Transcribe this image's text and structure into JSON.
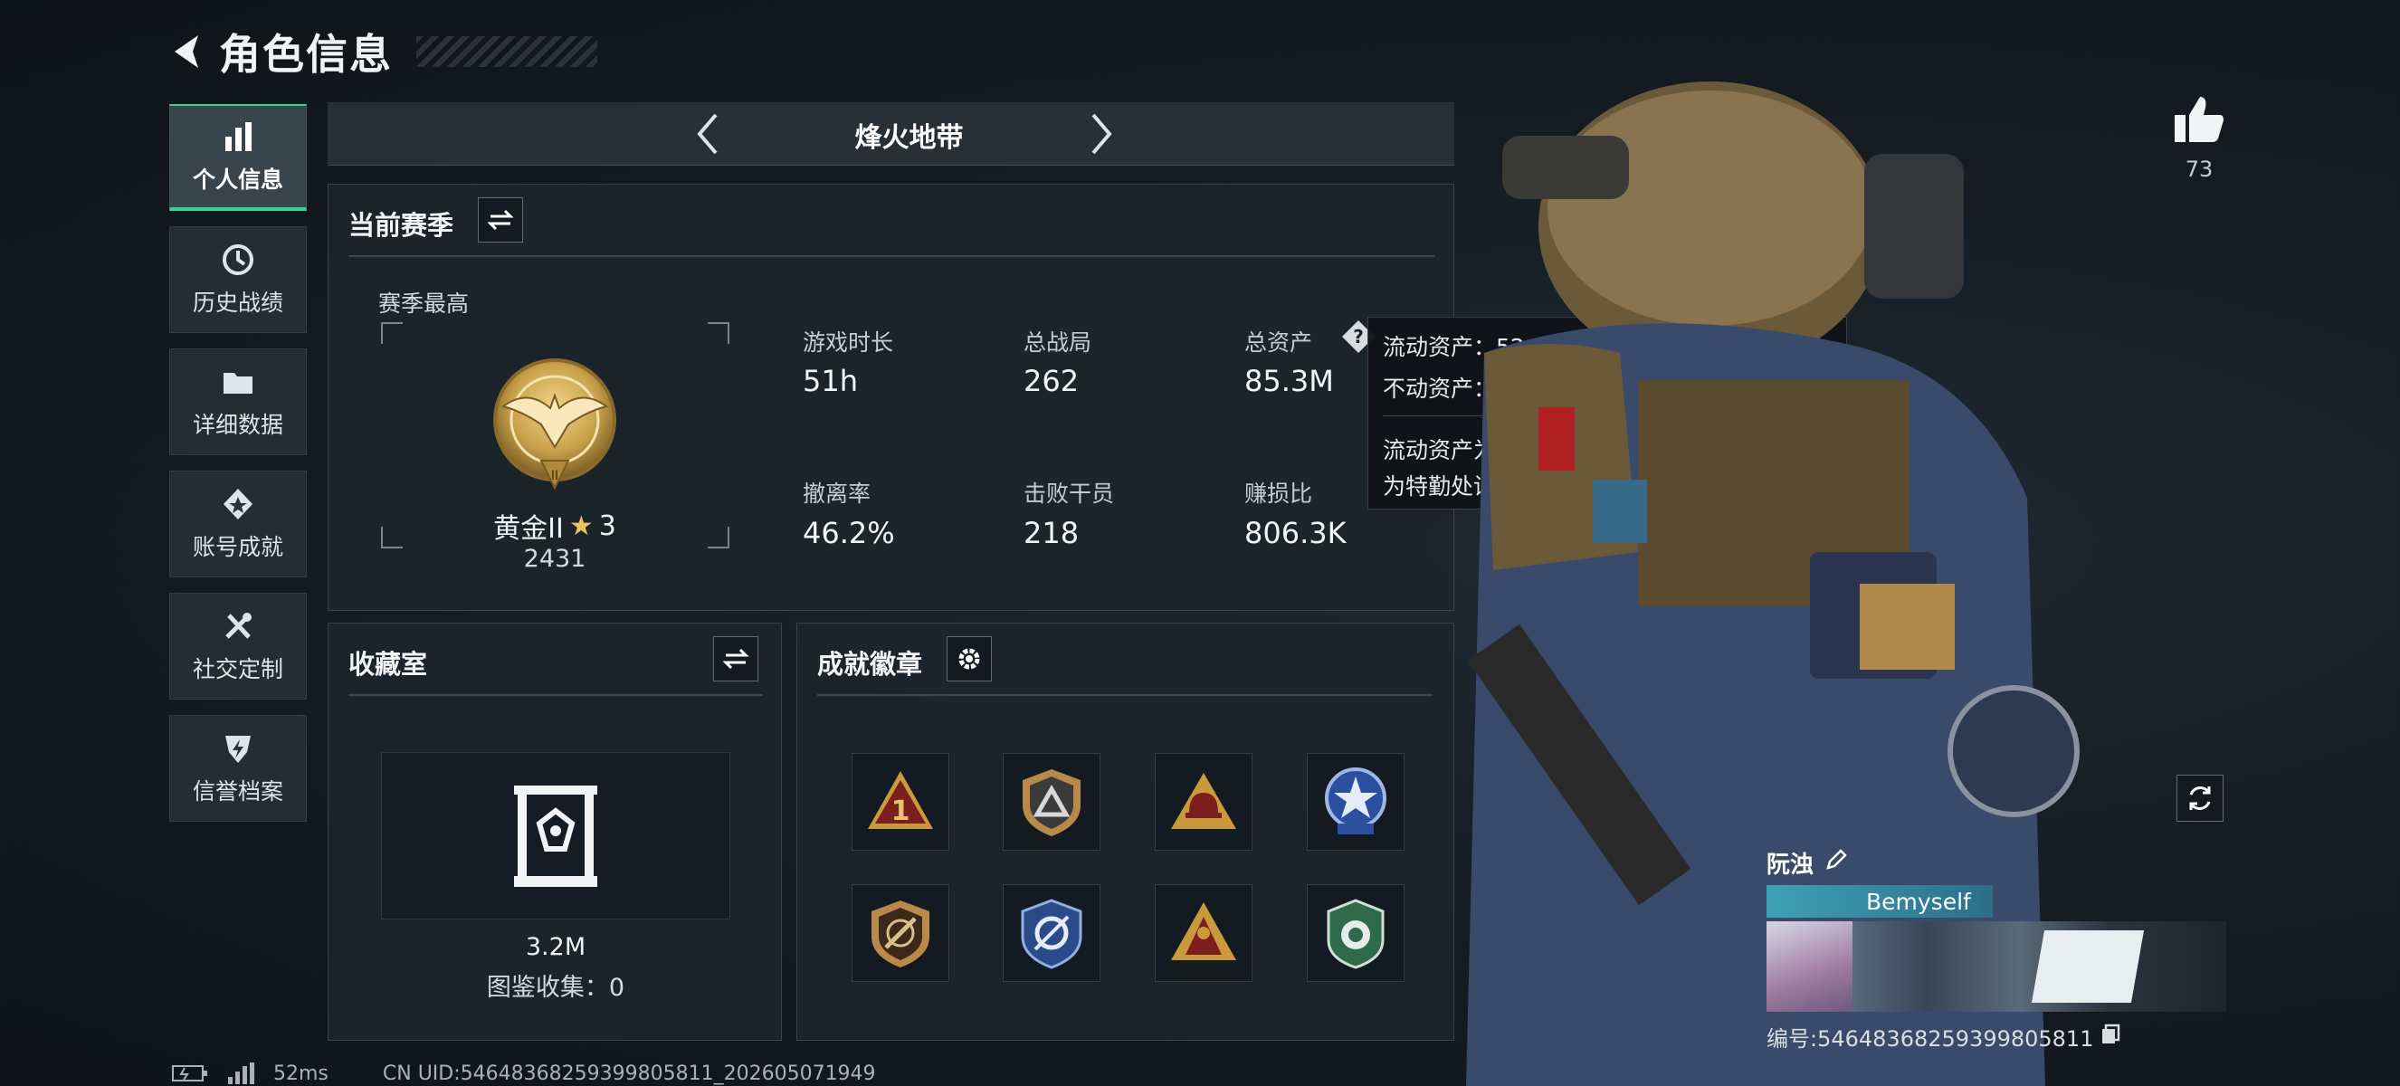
{
  "header": {
    "title": "角色信息"
  },
  "sidebar": {
    "items": [
      {
        "label": "个人信息",
        "icon": "bar-chart-icon",
        "active": true
      },
      {
        "label": "历史战绩",
        "icon": "history-icon"
      },
      {
        "label": "详细数据",
        "icon": "folder-icon"
      },
      {
        "label": "账号成就",
        "icon": "medal-icon"
      },
      {
        "label": "社交定制",
        "icon": "tools-icon"
      },
      {
        "label": "信誉档案",
        "icon": "shield-icon"
      }
    ]
  },
  "mode_selector": {
    "label": "烽火地带"
  },
  "season": {
    "title": "当前赛季",
    "best_label": "赛季最高",
    "rank_name": "黄金II",
    "rank_stars": "3",
    "rank_score": "2431",
    "stats": [
      {
        "label": "游戏时长",
        "value": "51h"
      },
      {
        "label": "总战局",
        "value": "262"
      },
      {
        "label": "总资产",
        "value": "85.3M"
      },
      {
        "label": "撤离率",
        "value": "46.2%"
      },
      {
        "label": "击败干员",
        "value": "218"
      },
      {
        "label": "赚损比",
        "value": "806.3K"
      }
    ]
  },
  "tooltip": {
    "liquid": "流动资产：52.8M",
    "fixed": "不动资产：32.5M",
    "desc_line1": "流动资产为仓库资产和哈夫币，不动资产",
    "desc_line2": "为特勤处设施和收藏室设施"
  },
  "collection": {
    "title": "收藏室",
    "value": "3.2M",
    "catalog": "图鉴收集：0"
  },
  "achievements": {
    "title": "成就徽章",
    "badges": [
      "badge-1",
      "badge-2",
      "badge-3",
      "badge-4",
      "badge-5",
      "badge-6",
      "badge-7",
      "badge-8"
    ]
  },
  "like": {
    "count": "73"
  },
  "player": {
    "name": "阮浊",
    "tag": "Bemyself",
    "id": "编号:5464836825939980581​1"
  },
  "footer": {
    "ping": "52ms",
    "uid": "CN UID:5464836825939980581​1_202605071949"
  },
  "colors": {
    "accent": "#2fd68e",
    "gold": "#c9a24a"
  }
}
